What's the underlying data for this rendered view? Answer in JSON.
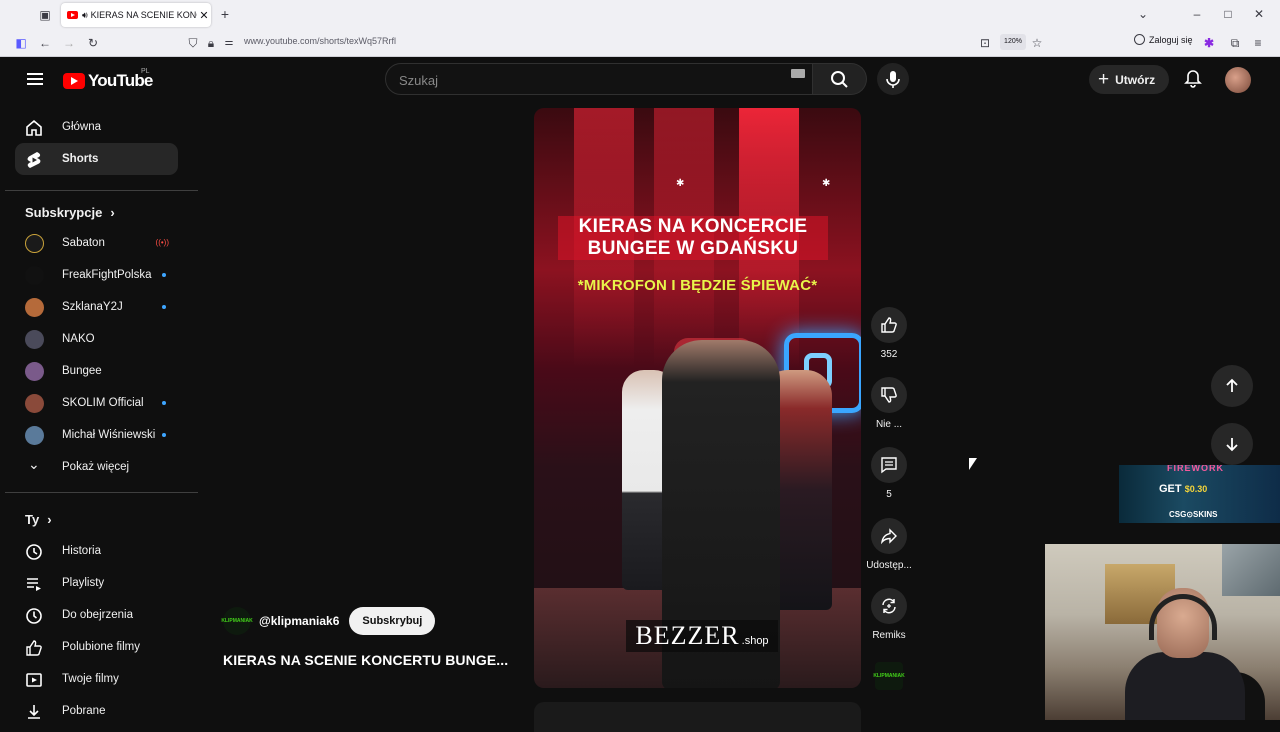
{
  "browser": {
    "tab_title": "KIERAS NA SCENIE KONCERTU",
    "url": "www.youtube.com/shorts/texWq57Rrfl",
    "zoom": "120%",
    "login_label": "Zaloguj się"
  },
  "header": {
    "logo_text": "YouTube",
    "country_code": "PL",
    "search_placeholder": "Szukaj",
    "create_label": "Utwórz"
  },
  "sidebar": {
    "main": [
      {
        "label": "Główna",
        "icon": "home-icon"
      },
      {
        "label": "Shorts",
        "icon": "shorts-icon"
      }
    ],
    "subscriptions_heading": "Subskrypcje",
    "channels": [
      {
        "label": "Sabaton",
        "live": true
      },
      {
        "label": "FreakFightPolska",
        "new": true
      },
      {
        "label": "SzklanaY2J",
        "new": true
      },
      {
        "label": "NAKO",
        "new": false
      },
      {
        "label": "Bungee",
        "new": false
      },
      {
        "label": "SKOLIM Official",
        "new": true
      },
      {
        "label": "Michał Wiśniewski",
        "new": true
      }
    ],
    "show_more": "Pokaż więcej",
    "you_heading": "Ty",
    "you_items": [
      {
        "label": "Historia",
        "icon": "history-icon"
      },
      {
        "label": "Playlisty",
        "icon": "playlists-icon"
      },
      {
        "label": "Do obejrzenia",
        "icon": "watch-later-icon"
      },
      {
        "label": "Polubione filmy",
        "icon": "liked-icon"
      },
      {
        "label": "Twoje filmy",
        "icon": "your-videos-icon"
      },
      {
        "label": "Pobrane",
        "icon": "downloads-icon"
      }
    ]
  },
  "short": {
    "caption_line1": "KIERAS NA KONCERCIE",
    "caption_line2": "BUNGEE W GDAŃSKU",
    "caption_line3": "*MIKROFON I BĘDZIE ŚPIEWAĆ*",
    "brand_text": "BEZZER",
    "brand_suffix": ".shop",
    "channel_handle": "@klipmaniak6",
    "channel_avatar_text": "KLIPMANIAK",
    "subscribe_label": "Subskrybuj",
    "title": "KIERAS NA SCENIE KONCERTU BUNGE..."
  },
  "actions": {
    "like_count": "352",
    "dislike_label": "Nie ...",
    "comment_count": "5",
    "share_label": "Udostęp...",
    "remix_label": "Remiks"
  },
  "overlay_ad": {
    "top_text": "FIREWORK",
    "get_text": "GET",
    "amount": "$0.30",
    "brand": "CSG⊙SKINS"
  }
}
